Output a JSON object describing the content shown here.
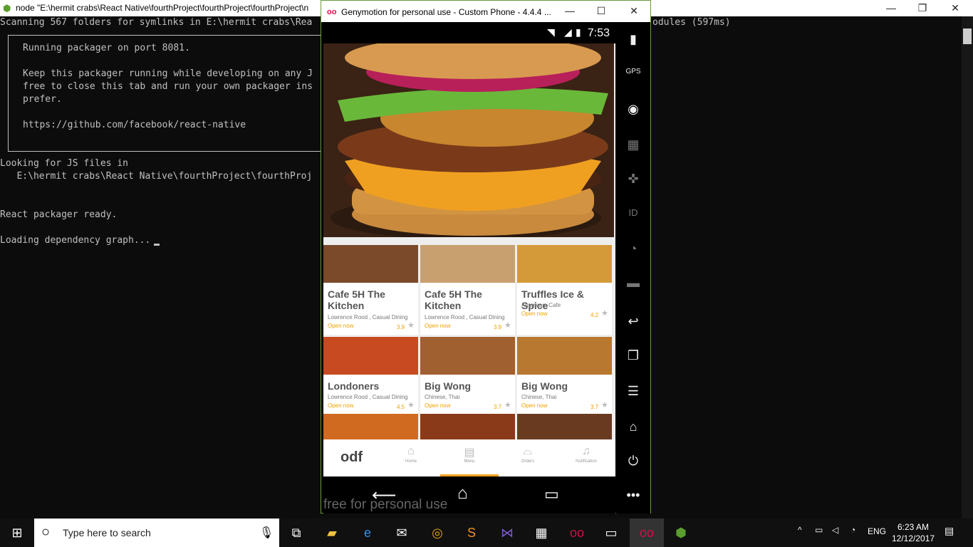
{
  "console": {
    "title": "node  \"E:\\hermit crabs\\React Native\\fourthProject\\fourthProject\\fourthProject\\n",
    "lines": [
      "Scanning 567 folders for symlinks in E:\\hermit crabs\\Rea",
      "odules (597ms)",
      "Running packager on port 8081.",
      "Keep this packager running while developing on any J",
      "free to close this tab and run your own packager ins",
      "prefer.",
      "https://github.com/facebook/react-native",
      "Looking for JS files in",
      "   E:\\hermit crabs\\React Native\\fourthProject\\fourthProj",
      "React packager ready.",
      "Loading dependency graph..."
    ]
  },
  "genymotion": {
    "title": "Genymotion for personal use - Custom Phone - 4.4.4 ...",
    "logo": "oo",
    "time": "7:53",
    "watermark": "free for personal use",
    "side_icons": [
      "battery-icon",
      "gps-icon",
      "camera-icon",
      "clapperboard-icon",
      "dpad-icon",
      "id-icon",
      "cast-icon",
      "sms-icon",
      "back-icon",
      "recent-apps-icon",
      "menu-icon",
      "home-icon",
      "power-icon",
      "more-icon"
    ],
    "side_labels": {
      "gps": "GPS",
      "id": "ID"
    }
  },
  "app": {
    "cards": [
      {
        "name": "Cafe 5H The Kitchen",
        "sub": "Lowrence Rood , Casual Dining",
        "open": "Open now",
        "rating": "3.9",
        "color": "#7a4a2a"
      },
      {
        "name": "Cafe 5H The Kitchen",
        "sub": "Lowrence Rood , Casual Dining",
        "open": "Open now",
        "rating": "3.9",
        "color": "#c8a070"
      },
      {
        "name": "Truffles Ice & Spice",
        "sub": "American, Cafe",
        "open": "Open now",
        "rating": "4.2",
        "color": "#d49a3a"
      },
      {
        "name": "Londoners",
        "sub": "Lowrence Rood , Casual Dining",
        "open": "Open now",
        "rating": "4.5",
        "color": "#c84a20"
      },
      {
        "name": "Big Wong",
        "sub": "Chinese, Thai",
        "open": "Open now",
        "rating": "3.7",
        "color": "#a06030"
      },
      {
        "name": "Big Wong",
        "sub": "Chinese, Thai",
        "open": "Open now",
        "rating": "3.7",
        "color": "#b87830"
      }
    ],
    "nav": {
      "brand": "odf",
      "items": [
        "Home",
        "Menu",
        "Orders",
        "Notification"
      ],
      "active": "Menu"
    }
  },
  "taskbar": {
    "search_placeholder": "Type here to search",
    "lang": "ENG",
    "time": "6:23 AM",
    "date": "12/12/2017"
  }
}
